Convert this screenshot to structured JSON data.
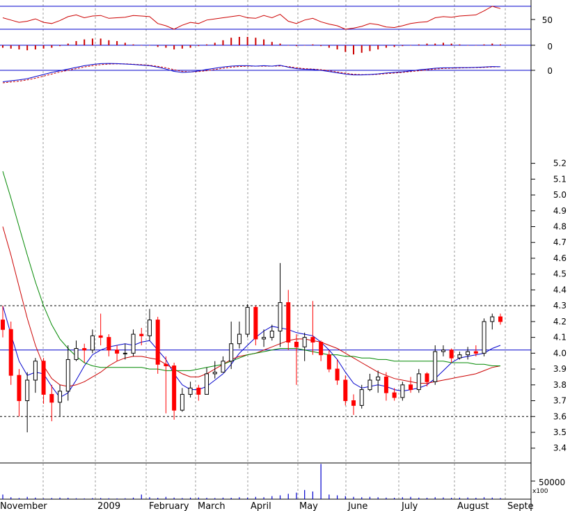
{
  "chart_data": {
    "type": "candlestick",
    "months": [
      "November",
      "2009",
      "February",
      "March",
      "April",
      "May",
      "June",
      "July",
      "August",
      "Septe"
    ],
    "price_axis": {
      "ticks": [
        "5.2",
        "5.1",
        "5.0",
        "4.9",
        "4.8",
        "4.7",
        "4.6",
        "4.5",
        "4.4",
        "4.3",
        "4.2",
        "4.1",
        "4.0",
        "3.9",
        "3.8",
        "3.7",
        "3.6",
        "3.5",
        "3.4"
      ],
      "ylim": [
        3.35,
        5.25
      ]
    },
    "reference_lines": {
      "dotted_high": 4.3,
      "solid_mid": 4.02,
      "dotted_low": 3.6
    },
    "price": {
      "open": [
        4.21,
        4.15,
        3.86,
        3.7,
        3.83,
        3.95,
        3.74,
        3.69,
        3.76,
        3.96,
        4.03,
        4.02,
        4.11,
        4.1,
        4.02,
        4.0,
        4.0,
        4.12,
        4.11,
        4.21,
        3.93,
        3.92,
        3.64,
        3.74,
        3.78,
        3.74,
        3.87,
        3.88,
        3.95,
        4.06,
        4.12,
        4.29,
        4.09,
        4.1,
        4.14,
        4.32,
        4.07,
        4.04,
        4.1,
        4.07,
        3.99,
        3.9,
        3.83,
        3.7,
        3.67,
        3.77,
        3.83,
        3.85,
        3.75,
        3.72,
        3.8,
        3.77,
        3.87,
        3.82,
        4.01,
        4.02,
        3.97,
        3.99,
        4.01,
        4.0,
        4.2,
        4.23
      ],
      "close": [
        4.15,
        3.86,
        3.7,
        3.83,
        3.95,
        3.74,
        3.69,
        3.76,
        3.96,
        4.03,
        4.02,
        4.11,
        4.1,
        4.02,
        4.0,
        4.0,
        4.12,
        4.11,
        4.21,
        3.93,
        3.92,
        3.64,
        3.74,
        3.78,
        3.74,
        3.87,
        3.88,
        3.95,
        4.06,
        4.12,
        4.29,
        4.09,
        4.1,
        4.14,
        4.32,
        4.07,
        4.04,
        4.1,
        4.07,
        3.99,
        3.9,
        3.83,
        3.7,
        3.67,
        3.77,
        3.83,
        3.85,
        3.75,
        3.72,
        3.8,
        3.77,
        3.87,
        3.82,
        4.01,
        4.02,
        3.97,
        3.99,
        4.01,
        4.0,
        4.2,
        4.23,
        4.2
      ],
      "high": [
        4.3,
        4.2,
        3.9,
        3.88,
        3.97,
        3.97,
        3.8,
        3.8,
        4.05,
        4.08,
        4.06,
        4.15,
        4.25,
        4.12,
        4.05,
        4.06,
        4.15,
        4.16,
        4.28,
        4.23,
        3.98,
        3.94,
        3.78,
        3.82,
        3.8,
        3.91,
        3.95,
        3.98,
        4.2,
        4.2,
        4.31,
        4.3,
        4.15,
        4.18,
        4.57,
        4.4,
        4.12,
        4.13,
        4.33,
        4.08,
        4.02,
        3.96,
        3.86,
        3.74,
        3.8,
        3.87,
        3.89,
        3.88,
        3.78,
        3.82,
        3.85,
        3.9,
        3.88,
        4.05,
        4.05,
        4.03,
        4.01,
        4.04,
        4.05,
        4.22,
        4.25,
        4.25
      ],
      "low": [
        4.1,
        3.8,
        3.6,
        3.5,
        3.75,
        3.68,
        3.57,
        3.6,
        3.7,
        3.95,
        3.94,
        4.0,
        4.05,
        3.98,
        3.95,
        3.96,
        3.98,
        4.05,
        4.08,
        3.87,
        3.62,
        3.58,
        3.63,
        3.72,
        3.7,
        3.78,
        3.84,
        3.88,
        3.9,
        4.03,
        4.1,
        4.05,
        4.04,
        4.08,
        4.04,
        4.02,
        3.8,
        3.95,
        3.99,
        3.95,
        3.88,
        3.8,
        3.67,
        3.61,
        3.65,
        3.76,
        3.75,
        3.7,
        3.7,
        3.7,
        3.75,
        3.75,
        3.79,
        3.8,
        3.98,
        3.94,
        3.96,
        3.96,
        3.98,
        3.98,
        4.15,
        4.18
      ]
    },
    "moving_averages": [
      {
        "color": "#0000cc",
        "values": [
          4.3,
          4.12,
          3.95,
          3.86,
          3.88,
          3.87,
          3.79,
          3.72,
          3.75,
          3.83,
          3.92,
          3.99,
          4.02,
          4.04,
          4.05,
          4.06,
          4.05,
          4.07,
          4.08,
          4.02,
          3.96,
          3.87,
          3.8,
          3.77,
          3.77,
          3.79,
          3.83,
          3.87,
          3.93,
          4.0,
          4.05,
          4.1,
          4.14,
          4.17,
          4.16,
          4.15,
          4.13,
          4.12,
          4.11,
          4.07,
          4.02,
          3.96,
          3.88,
          3.81,
          3.78,
          3.79,
          3.8,
          3.79,
          3.77,
          3.76,
          3.77,
          3.78,
          3.8,
          3.84,
          3.89,
          3.94,
          3.97,
          3.98,
          3.99,
          4.0,
          4.03,
          4.05
        ]
      },
      {
        "color": "#cc0000",
        "values": [
          4.8,
          4.62,
          4.42,
          4.22,
          4.05,
          3.92,
          3.84,
          3.8,
          3.79,
          3.8,
          3.82,
          3.85,
          3.88,
          3.92,
          3.95,
          3.97,
          3.98,
          3.98,
          3.97,
          3.96,
          3.93,
          3.9,
          3.87,
          3.85,
          3.85,
          3.87,
          3.9,
          3.93,
          3.96,
          3.98,
          3.99,
          4.0,
          4.02,
          4.04,
          4.06,
          4.08,
          4.09,
          4.09,
          4.08,
          4.07,
          4.05,
          4.03,
          4.0,
          3.97,
          3.94,
          3.91,
          3.88,
          3.86,
          3.84,
          3.83,
          3.82,
          3.81,
          3.81,
          3.82,
          3.83,
          3.84,
          3.85,
          3.86,
          3.87,
          3.89,
          3.91,
          3.92
        ]
      },
      {
        "color": "#008800",
        "values": [
          5.15,
          4.98,
          4.8,
          4.62,
          4.45,
          4.3,
          4.18,
          4.09,
          4.03,
          3.98,
          3.94,
          3.92,
          3.91,
          3.91,
          3.91,
          3.91,
          3.91,
          3.91,
          3.9,
          3.9,
          3.89,
          3.89,
          3.89,
          3.89,
          3.9,
          3.91,
          3.92,
          3.93,
          3.95,
          3.97,
          3.99,
          4.0,
          4.01,
          4.02,
          4.03,
          4.03,
          4.03,
          4.02,
          4.01,
          4.0,
          3.99,
          3.99,
          3.98,
          3.98,
          3.97,
          3.97,
          3.96,
          3.96,
          3.95,
          3.95,
          3.95,
          3.95,
          3.95,
          3.95,
          3.95,
          3.94,
          3.94,
          3.94,
          3.93,
          3.93,
          3.92,
          3.92
        ]
      }
    ],
    "oscillator_1": {
      "tick": "50",
      "values": [
        70,
        66,
        62,
        64,
        68,
        62,
        60,
        65,
        72,
        75,
        70,
        73,
        74,
        69,
        70,
        71,
        74,
        73,
        72,
        60,
        56,
        50,
        57,
        62,
        60,
        66,
        68,
        70,
        72,
        74,
        70,
        69,
        74,
        70,
        76,
        64,
        60,
        66,
        69,
        63,
        59,
        56,
        50,
        52,
        55,
        60,
        58,
        54,
        53,
        56,
        60,
        62,
        63,
        70,
        72,
        71,
        73,
        74,
        75,
        82,
        90,
        86
      ]
    },
    "oscillator_2": {
      "tick": "0",
      "values": [
        -0.3,
        -0.4,
        -0.5,
        -0.6,
        -0.5,
        -0.4,
        -0.3,
        -0.1,
        0.2,
        0.5,
        0.7,
        0.8,
        0.8,
        0.6,
        0.5,
        0.3,
        0.1,
        0.0,
        0.0,
        -0.2,
        -0.3,
        -0.5,
        -0.4,
        -0.3,
        -0.1,
        0.1,
        0.3,
        0.6,
        0.9,
        1.0,
        1.0,
        0.9,
        0.7,
        0.4,
        0.2,
        0.0,
        -0.1,
        0.0,
        0.1,
        -0.1,
        -0.3,
        -0.5,
        -0.8,
        -1.1,
        -0.9,
        -0.7,
        -0.5,
        -0.3,
        -0.2,
        -0.1,
        0.0,
        0.1,
        0.2,
        0.2,
        0.3,
        0.2,
        0.1,
        0.0,
        0.0,
        0.1,
        0.2,
        0.1
      ]
    },
    "oscillator_3": {
      "tick": "0",
      "line_a": [
        -0.55,
        -0.5,
        -0.46,
        -0.4,
        -0.3,
        -0.2,
        -0.1,
        -0.02,
        0.06,
        0.14,
        0.22,
        0.28,
        0.32,
        0.33,
        0.32,
        0.3,
        0.28,
        0.25,
        0.22,
        0.15,
        0.06,
        -0.05,
        -0.1,
        -0.08,
        -0.03,
        0.04,
        0.1,
        0.16,
        0.2,
        0.22,
        0.22,
        0.2,
        0.22,
        0.2,
        0.24,
        0.15,
        0.08,
        0.05,
        0.04,
        0.0,
        -0.06,
        -0.12,
        -0.18,
        -0.22,
        -0.22,
        -0.2,
        -0.17,
        -0.13,
        -0.1,
        -0.07,
        -0.03,
        0.02,
        0.06,
        0.1,
        0.12,
        0.12,
        0.13,
        0.13,
        0.14,
        0.16,
        0.18,
        0.17
      ],
      "line_b": [
        -0.6,
        -0.56,
        -0.52,
        -0.46,
        -0.38,
        -0.28,
        -0.18,
        -0.08,
        0.0,
        0.08,
        0.16,
        0.22,
        0.27,
        0.3,
        0.31,
        0.31,
        0.29,
        0.27,
        0.24,
        0.19,
        0.12,
        0.03,
        -0.05,
        -0.08,
        -0.06,
        -0.02,
        0.04,
        0.1,
        0.15,
        0.18,
        0.2,
        0.2,
        0.2,
        0.2,
        0.21,
        0.18,
        0.12,
        0.08,
        0.06,
        0.03,
        -0.02,
        -0.08,
        -0.14,
        -0.19,
        -0.21,
        -0.21,
        -0.19,
        -0.16,
        -0.13,
        -0.1,
        -0.06,
        -0.02,
        0.02,
        0.06,
        0.09,
        0.1,
        0.11,
        0.12,
        0.13,
        0.14,
        0.16,
        0.17
      ]
    },
    "volume": {
      "tick_label": "50000",
      "scale_label": "x100",
      "values": [
        60,
        25,
        15,
        30,
        20,
        10,
        15,
        20,
        18,
        12,
        10,
        14,
        15,
        12,
        10,
        12,
        20,
        60,
        25,
        18,
        30,
        20,
        15,
        20,
        22,
        18,
        15,
        20,
        18,
        25,
        20,
        30,
        25,
        40,
        50,
        70,
        85,
        120,
        100,
        80,
        60,
        50,
        40,
        30,
        25,
        30,
        25,
        20,
        18,
        25,
        30,
        20,
        18,
        25,
        22,
        18,
        20,
        22,
        18,
        25,
        20,
        15
      ],
      "peak": {
        "index": 39,
        "value": 460
      }
    },
    "colors": {
      "up": "#000000",
      "down": "#ff0000",
      "reference": "#0000cc",
      "grid": "#999999",
      "oscillator_1": "#cc0000"
    }
  }
}
